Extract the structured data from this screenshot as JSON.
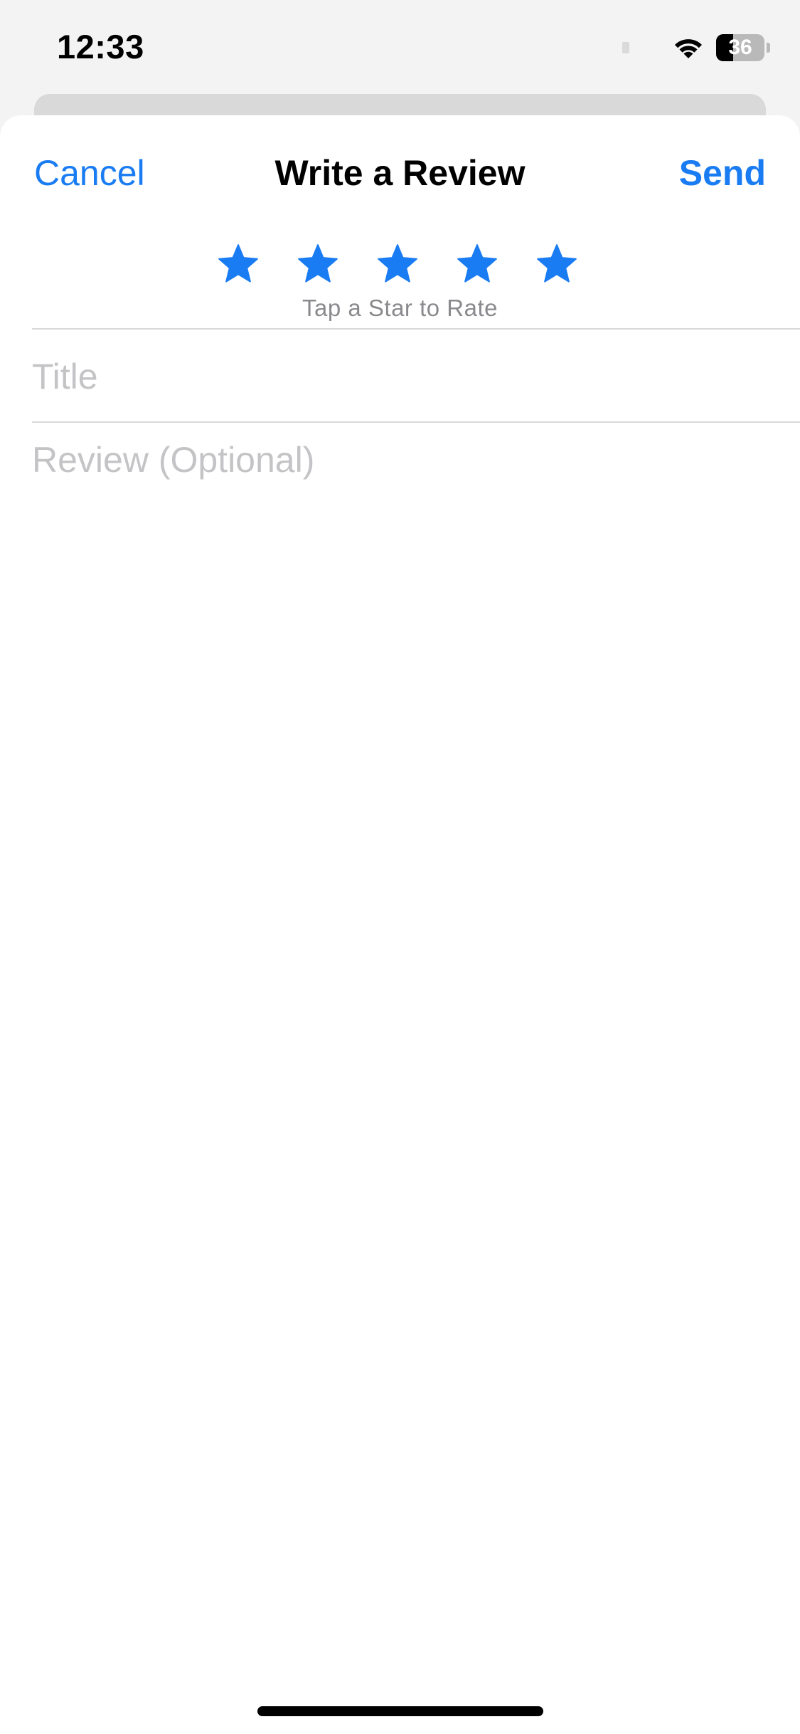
{
  "status_bar": {
    "time": "12:33",
    "battery_level": "36",
    "battery_fraction": 0.36,
    "wifi_icon": "wifi-icon"
  },
  "nav": {
    "cancel_label": "Cancel",
    "title": "Write a Review",
    "send_label": "Send"
  },
  "rating": {
    "stars": [
      "star-icon",
      "star-icon",
      "star-icon",
      "star-icon",
      "star-icon"
    ],
    "star_count": 5,
    "star_color": "#1a7cf2",
    "hint": "Tap a Star to Rate"
  },
  "form": {
    "title_placeholder": "Title",
    "title_value": "",
    "review_placeholder": "Review (Optional)",
    "review_value": ""
  },
  "colors": {
    "accent": "#1a7cf2",
    "placeholder": "#c4c4c7",
    "divider": "#d9d9d9",
    "hint": "#8a8a8e"
  }
}
